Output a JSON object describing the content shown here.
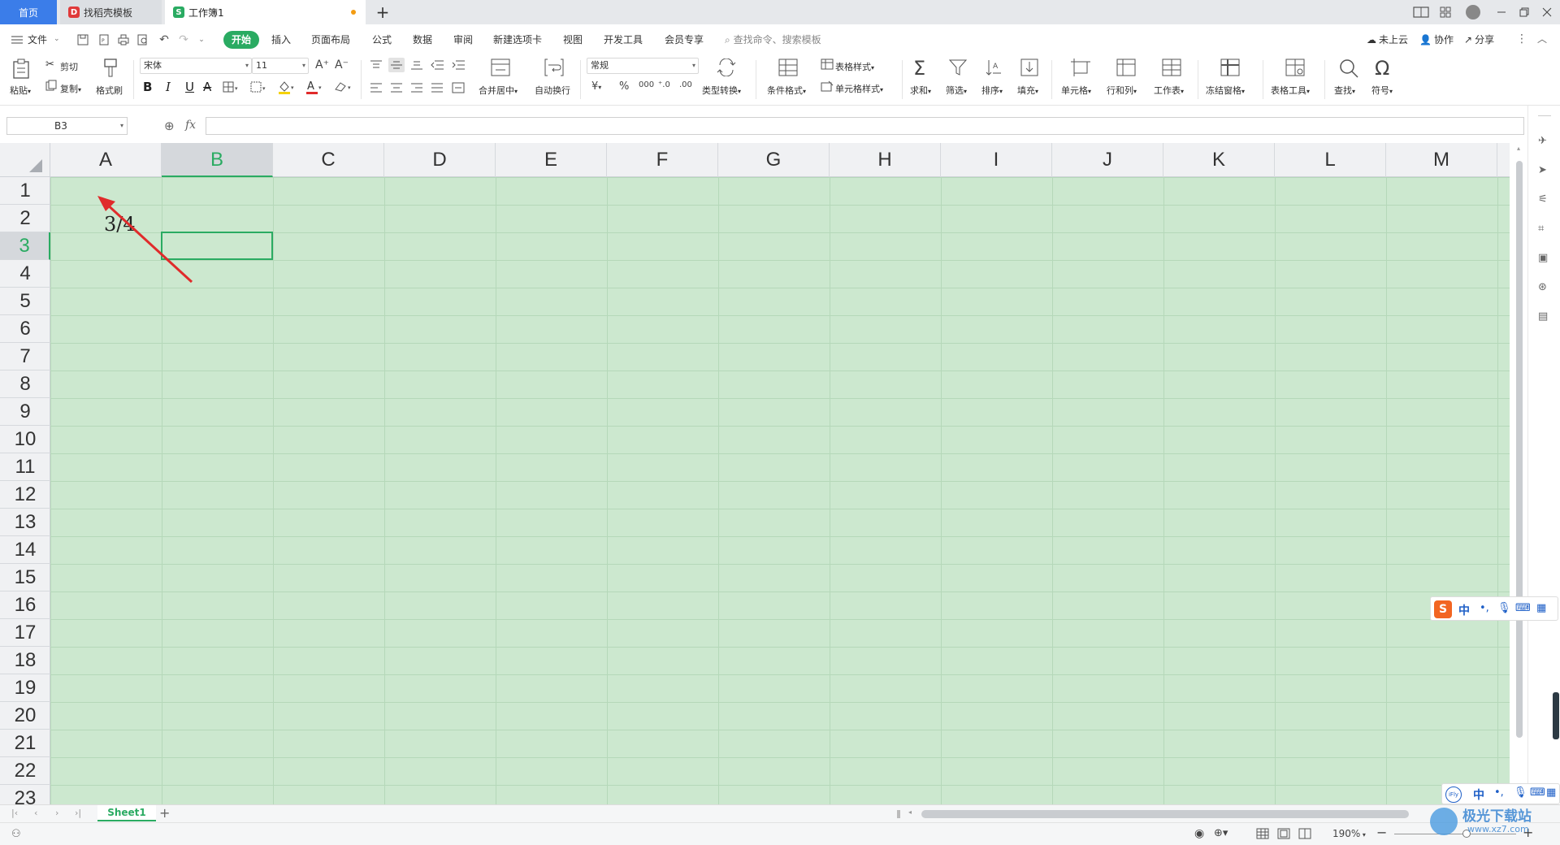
{
  "tabs": {
    "home": "首页",
    "template": "找稻壳模板",
    "workbook": "工作簿1",
    "add": "+"
  },
  "menu": {
    "file": "文件",
    "items": [
      "开始",
      "插入",
      "页面布局",
      "公式",
      "数据",
      "审阅",
      "新建选项卡",
      "视图",
      "开发工具",
      "会员专享"
    ],
    "search_placeholder": "查找命令、搜索模板",
    "cloud": "未上云",
    "collab": "协作",
    "share": "分享"
  },
  "ribbon": {
    "paste": "粘贴",
    "cut": "剪切",
    "copy": "复制",
    "format_painter": "格式刷",
    "font_name": "宋体",
    "font_size": "11",
    "bold": "B",
    "italic": "I",
    "underline": "U",
    "merge_center": "合并居中",
    "wrap": "自动换行",
    "number_format": "常规",
    "type_convert": "类型转换",
    "cond_format": "条件格式",
    "table_style": "表格样式",
    "cell_style": "单元格样式",
    "sum": "求和",
    "filter": "筛选",
    "sort": "排序",
    "fill": "填充",
    "cell": "单元格",
    "rowcol": "行和列",
    "worksheet": "工作表",
    "freeze": "冻结窗格",
    "table_tools": "表格工具",
    "find": "查找",
    "symbol": "符号",
    "percent": "%",
    "thousands": "000"
  },
  "formula_bar": {
    "name_box": "B3",
    "fx": "fx",
    "value": ""
  },
  "grid": {
    "columns": [
      "A",
      "B",
      "C",
      "D",
      "E",
      "F",
      "G",
      "H",
      "I",
      "J",
      "K",
      "L",
      "M"
    ],
    "rows": [
      "1",
      "2",
      "3",
      "4",
      "5",
      "6",
      "7",
      "8",
      "9",
      "10",
      "11",
      "12",
      "13",
      "14",
      "15",
      "16",
      "17",
      "18",
      "19",
      "20",
      "21",
      "22",
      "23"
    ],
    "selected_column": "B",
    "selected_row": "3",
    "cell_a1": "3/4"
  },
  "sheets": {
    "active": "Sheet1",
    "add": "+"
  },
  "status": {
    "zoom": "190%",
    "minus": "−",
    "plus": "+",
    "ime_lang": "中",
    "ime_mode": "中"
  },
  "watermark": {
    "site": "极光下载站",
    "url": "www.xz7.com"
  },
  "colors": {
    "accent": "#2aab62",
    "tab_home": "#3b7de9",
    "sheet_bg": "#cce8cf",
    "arrow": "#e02b2b"
  }
}
